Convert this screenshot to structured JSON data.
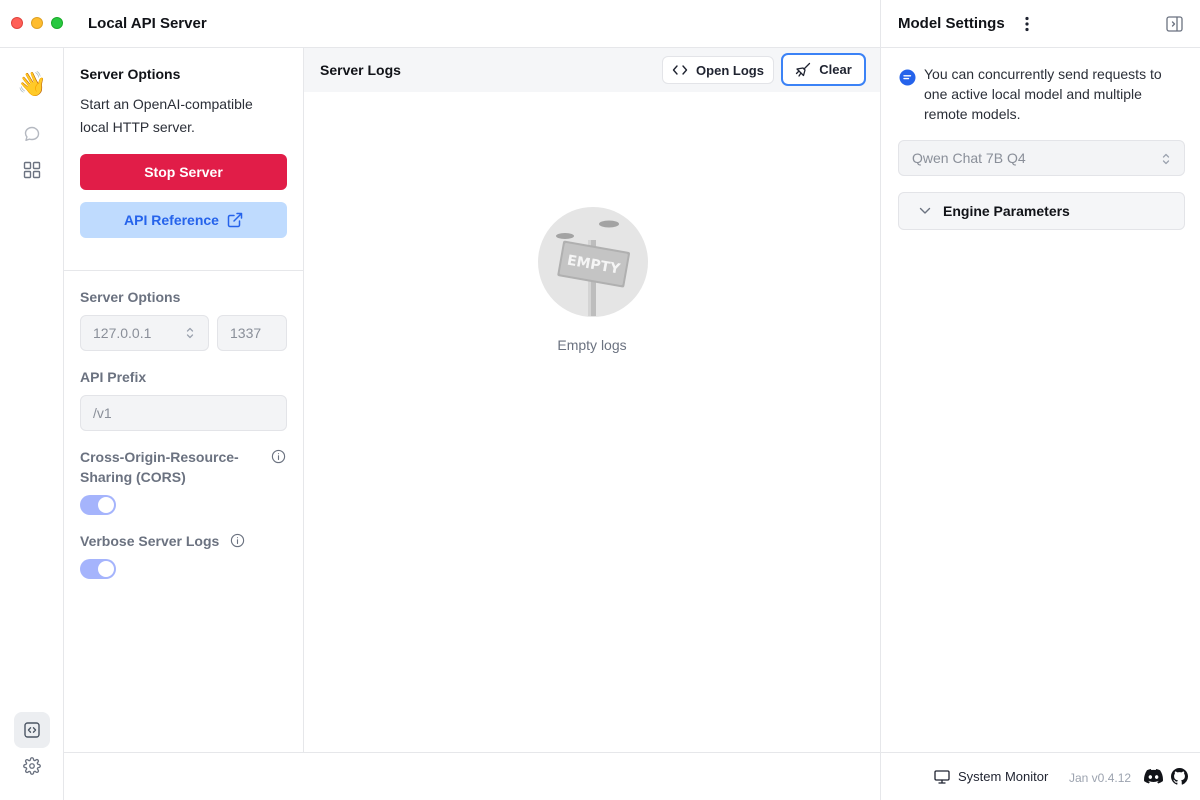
{
  "window": {
    "title": "Local API Server"
  },
  "rail": {
    "icons": [
      "waving-hand-icon",
      "chat-icon",
      "grid-icon",
      "code-icon",
      "gear-icon"
    ]
  },
  "left_panel": {
    "title": "Server Options",
    "description": "Start an OpenAI-compatible local HTTP server.",
    "stop_button": "Stop Server",
    "api_reference_button": "API Reference",
    "section_title": "Server Options",
    "host_value": "127.0.0.1",
    "port_value": "1337",
    "api_prefix_label": "API Prefix",
    "api_prefix_value": "/v1",
    "cors_label": "Cross-Origin-Resource-Sharing (CORS)",
    "cors_enabled": true,
    "verbose_label": "Verbose Server Logs",
    "verbose_enabled": true
  },
  "logs": {
    "title": "Server Logs",
    "open_logs_button": "Open Logs",
    "clear_button": "Clear",
    "empty_sign": "EMPTY",
    "empty_text": "Empty logs"
  },
  "right_panel": {
    "title": "Model Settings",
    "note": "You can concurrently send requests to one active local model and multiple remote models.",
    "model_selected": "Qwen Chat 7B Q4",
    "engine_parameters": "Engine Parameters"
  },
  "status_bar": {
    "system_monitor": "System Monitor",
    "version": "Jan v0.4.12"
  },
  "colors": {
    "danger": "#e11d48",
    "accent": "#3b82f6",
    "toggle": "#a5b4fc"
  }
}
